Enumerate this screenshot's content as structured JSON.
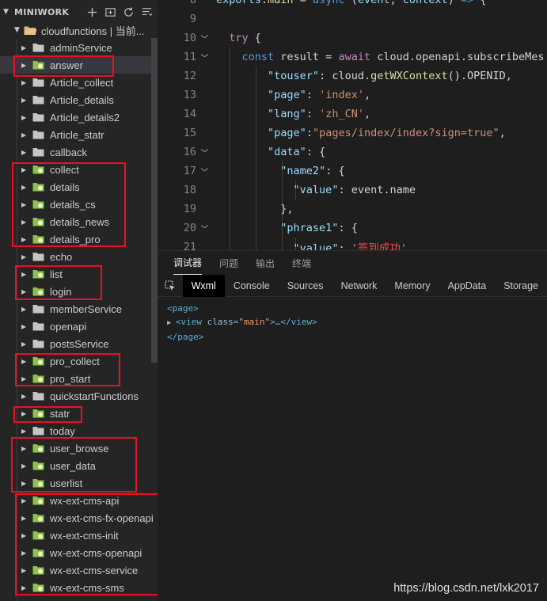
{
  "explorer": {
    "title": "MINIWORK",
    "root_label": "cloudfunctions | 当前...",
    "toolbar_icons": [
      "new-file-icon",
      "new-folder-icon",
      "refresh-icon",
      "collapse-all-icon"
    ],
    "items": [
      {
        "label": "adminService",
        "type": "folder"
      },
      {
        "label": "answer",
        "type": "cloud"
      },
      {
        "label": "Article_collect",
        "type": "folder"
      },
      {
        "label": "Article_details",
        "type": "folder"
      },
      {
        "label": "Article_details2",
        "type": "folder"
      },
      {
        "label": "Article_statr",
        "type": "folder"
      },
      {
        "label": "callback",
        "type": "folder"
      },
      {
        "label": "collect",
        "type": "cloud"
      },
      {
        "label": "details",
        "type": "cloud"
      },
      {
        "label": "details_cs",
        "type": "cloud"
      },
      {
        "label": "details_news",
        "type": "cloud"
      },
      {
        "label": "details_pro",
        "type": "cloud"
      },
      {
        "label": "echo",
        "type": "folder"
      },
      {
        "label": "list",
        "type": "cloud"
      },
      {
        "label": "login",
        "type": "cloud"
      },
      {
        "label": "memberService",
        "type": "folder"
      },
      {
        "label": "openapi",
        "type": "folder"
      },
      {
        "label": "postsService",
        "type": "folder"
      },
      {
        "label": "pro_collect",
        "type": "cloud"
      },
      {
        "label": "pro_start",
        "type": "cloud"
      },
      {
        "label": "quickstartFunctions",
        "type": "folder"
      },
      {
        "label": "statr",
        "type": "cloud"
      },
      {
        "label": "today",
        "type": "folder"
      },
      {
        "label": "user_browse",
        "type": "cloud"
      },
      {
        "label": "user_data",
        "type": "cloud"
      },
      {
        "label": "userlist",
        "type": "cloud"
      },
      {
        "label": "wx-ext-cms-api",
        "type": "cloud"
      },
      {
        "label": "wx-ext-cms-fx-openapi",
        "type": "cloud"
      },
      {
        "label": "wx-ext-cms-init",
        "type": "cloud"
      },
      {
        "label": "wx-ext-cms-openapi",
        "type": "cloud"
      },
      {
        "label": "wx-ext-cms-service",
        "type": "cloud"
      },
      {
        "label": "wx-ext-cms-sms",
        "type": "cloud"
      }
    ],
    "selected_index": 1
  },
  "editor": {
    "lines": [
      {
        "n": "8",
        "fold": false,
        "tokens": [
          [
            "exports",
            "vr"
          ],
          [
            ".",
            "pl"
          ],
          [
            "main",
            "fn"
          ],
          [
            " = ",
            "pl"
          ],
          [
            "async",
            "kw"
          ],
          [
            " (",
            "pl"
          ],
          [
            "event",
            "vr"
          ],
          [
            ", ",
            "pl"
          ],
          [
            "context",
            "vr"
          ],
          [
            ") ",
            "pl"
          ],
          [
            "=>",
            "kw"
          ],
          [
            " {",
            "pl"
          ]
        ]
      },
      {
        "n": "9",
        "fold": false,
        "tokens": []
      },
      {
        "n": "10",
        "fold": true,
        "tokens": [
          [
            "  ",
            "pl"
          ],
          [
            "try",
            "ctl"
          ],
          [
            " {",
            "pl"
          ]
        ]
      },
      {
        "n": "11",
        "fold": true,
        "tokens": [
          [
            "    ",
            "pl"
          ],
          [
            "const",
            "kw"
          ],
          [
            " result = ",
            "pl"
          ],
          [
            "await",
            "ctl"
          ],
          [
            " cloud.openapi.subscribeMes",
            "pl"
          ]
        ]
      },
      {
        "n": "12",
        "fold": false,
        "tokens": [
          [
            "        ",
            "pl"
          ],
          [
            "\"touser\"",
            "prop"
          ],
          [
            ": cloud.",
            "pl"
          ],
          [
            "getWXContext",
            "fn"
          ],
          [
            "().OPENID,",
            "pl"
          ]
        ]
      },
      {
        "n": "13",
        "fold": false,
        "tokens": [
          [
            "        ",
            "pl"
          ],
          [
            "\"page\"",
            "prop"
          ],
          [
            ": ",
            "pl"
          ],
          [
            "'index'",
            "str"
          ],
          [
            ",",
            "pl"
          ]
        ]
      },
      {
        "n": "14",
        "fold": false,
        "tokens": [
          [
            "        ",
            "pl"
          ],
          [
            "\"lang\"",
            "prop"
          ],
          [
            ": ",
            "pl"
          ],
          [
            "'zh_CN'",
            "str"
          ],
          [
            ",",
            "pl"
          ]
        ]
      },
      {
        "n": "15",
        "fold": false,
        "tokens": [
          [
            "        ",
            "pl"
          ],
          [
            "\"page\"",
            "prop"
          ],
          [
            ":",
            "pl"
          ],
          [
            "\"pages/index/index?sign=true\"",
            "str"
          ],
          [
            ",",
            "pl"
          ]
        ]
      },
      {
        "n": "16",
        "fold": true,
        "tokens": [
          [
            "        ",
            "pl"
          ],
          [
            "\"data\"",
            "prop"
          ],
          [
            ": {",
            "pl"
          ]
        ]
      },
      {
        "n": "17",
        "fold": true,
        "tokens": [
          [
            "          ",
            "pl"
          ],
          [
            "\"name2\"",
            "prop"
          ],
          [
            ": {",
            "pl"
          ]
        ]
      },
      {
        "n": "18",
        "fold": false,
        "tokens": [
          [
            "            ",
            "pl"
          ],
          [
            "\"value\"",
            "prop"
          ],
          [
            ": event.name",
            "pl"
          ]
        ]
      },
      {
        "n": "19",
        "fold": false,
        "tokens": [
          [
            "          ",
            "pl"
          ],
          [
            "},",
            "pl"
          ]
        ]
      },
      {
        "n": "20",
        "fold": true,
        "tokens": [
          [
            "          ",
            "pl"
          ],
          [
            "\"phrase1\"",
            "prop"
          ],
          [
            ": {",
            "pl"
          ]
        ]
      },
      {
        "n": "21",
        "fold": false,
        "tokens": [
          [
            "            ",
            "pl"
          ],
          [
            "\"value\"",
            "prop"
          ],
          [
            ": ",
            "pl"
          ],
          [
            "'",
            "str"
          ],
          [
            "签到成功",
            "str-red"
          ],
          [
            "'",
            "str"
          ]
        ]
      }
    ]
  },
  "panel": {
    "tabs": [
      "调试器",
      "问题",
      "输出",
      "终端"
    ],
    "active_tab": 0,
    "devtools_tabs": [
      "Wxml",
      "Console",
      "Sources",
      "Network",
      "Memory",
      "AppData",
      "Storage"
    ],
    "active_devtools_tab": 0,
    "dom": {
      "line1": "<page>",
      "line2_open": "<view",
      "line2_attr_name": "class",
      "line2_attr_value": "\"main\"",
      "line2_rest": ">…</view>",
      "line3": "</page>"
    }
  },
  "watermark": "https://blog.csdn.net/lxk2017",
  "colors": {
    "cloud_folder": "#8dc149",
    "plain_folder": "#c5c5c5",
    "highlight_box": "#e81123"
  }
}
